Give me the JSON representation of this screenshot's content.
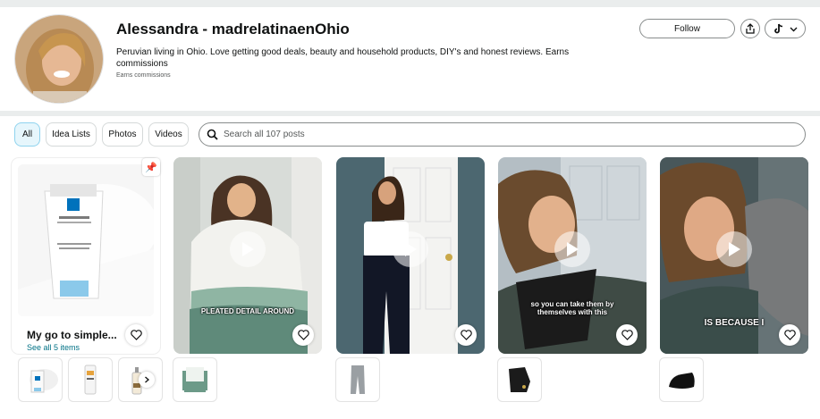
{
  "profile": {
    "name": "Alessandra - madrelatinaenOhio",
    "bio": "Peruvian living in Ohio. Love getting good deals, beauty and household products, DIY's and honest reviews. Earns commissions",
    "earns_note": "Earns commissions",
    "follow_label": "Follow",
    "social_icon": "tiktok-icon"
  },
  "filters": {
    "tabs": [
      {
        "label": "All",
        "active": true
      },
      {
        "label": "Idea Lists",
        "active": false
      },
      {
        "label": "Photos",
        "active": false
      },
      {
        "label": "Videos",
        "active": false
      }
    ],
    "search_placeholder": "Search all 107 posts"
  },
  "idea_list": {
    "title": "My go to simple...",
    "link": "See all 5 items"
  },
  "videos": [
    {
      "caption": "PLEATED DETAIL AROUND"
    },
    {
      "caption": ""
    },
    {
      "caption": "so you can take them by themselves with this"
    },
    {
      "caption": "IS BECAUSE I"
    }
  ],
  "colors": {
    "accent_link": "#007185",
    "active_pill_bg": "#e6f6fc",
    "page_bg": "#eaeded"
  }
}
